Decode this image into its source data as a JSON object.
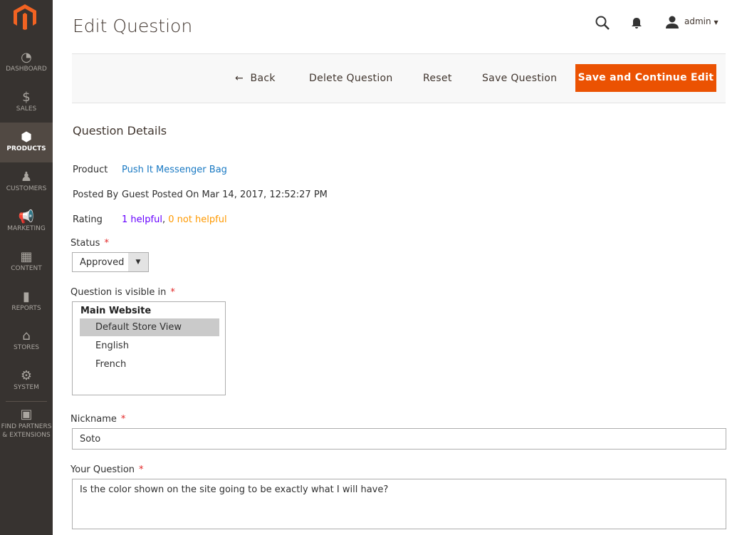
{
  "sidebar": {
    "items": [
      {
        "label": "DASHBOARD",
        "icon": "dashboard-icon",
        "glyph": "◔"
      },
      {
        "label": "SALES",
        "icon": "dollar-icon",
        "glyph": "$"
      },
      {
        "label": "PRODUCTS",
        "icon": "box-icon",
        "glyph": "⬢"
      },
      {
        "label": "CUSTOMERS",
        "icon": "person-icon",
        "glyph": "♟"
      },
      {
        "label": "MARKETING",
        "icon": "megaphone-icon",
        "glyph": "📢"
      },
      {
        "label": "CONTENT",
        "icon": "layout-icon",
        "glyph": "▦"
      },
      {
        "label": "REPORTS",
        "icon": "bar-chart-icon",
        "glyph": "▮"
      },
      {
        "label": "STORES",
        "icon": "storefront-icon",
        "glyph": "⌂"
      },
      {
        "label": "SYSTEM",
        "icon": "gear-icon",
        "glyph": "⚙"
      },
      {
        "label": "FIND PARTNERS & EXTENSIONS",
        "icon": "lego-icon",
        "glyph": "▣"
      }
    ],
    "active": "PRODUCTS"
  },
  "header": {
    "title": "Edit Question",
    "user": "admin"
  },
  "toolbar": {
    "back": "Back",
    "delete": "Delete Question",
    "reset": "Reset",
    "save": "Save Question",
    "save_continue": "Save and Continue Edit"
  },
  "details": {
    "heading": "Question Details",
    "product_label": "Product",
    "product_value": "Push It Messenger Bag",
    "posted_label": "Posted By",
    "posted_value": "Guest Posted On Mar 14, 2017, 12:52:27 PM",
    "rating_label": "Rating",
    "helpful": "1 helpful",
    "sep": ",",
    "not_helpful": "0 not helpful"
  },
  "form": {
    "status_label": "Status",
    "status_value": "Approved",
    "visible_label": "Question is visible in",
    "visible_group": "Main Website",
    "visible_options": [
      "Default Store View",
      "English",
      "French"
    ],
    "visible_selected": "Default Store View",
    "nickname_label": "Nickname",
    "nickname_value": "Soto",
    "question_label": "Your Question",
    "question_value": "Is the color shown on the site going to be exactly what I will have?",
    "required": "*"
  },
  "colors": {
    "accent": "#eb5202",
    "link": "#1979c3",
    "helpful": "#6600ff",
    "not_helpful": "#ff9900",
    "sidebar": "#373330"
  }
}
